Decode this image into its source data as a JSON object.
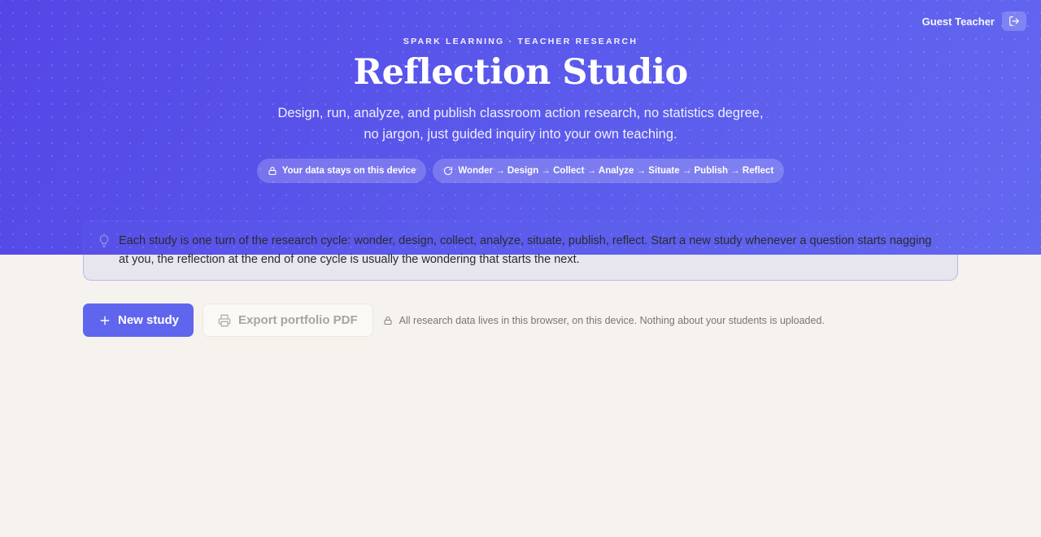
{
  "header": {
    "user_name": "Guest Teacher",
    "eyebrow": "SPARK LEARNING · TEACHER RESEARCH",
    "title": "Reflection Studio",
    "subtitle": "Design, run, analyze, and publish classroom action research, no statistics degree, no jargon, just guided inquiry into your own teaching.",
    "pills": [
      {
        "icon": "lock-icon",
        "label": "Your data stays on this device"
      },
      {
        "icon": "refresh-icon",
        "label": "Wonder → Design → Collect → Analyze → Situate → Publish → Reflect"
      }
    ]
  },
  "callout": {
    "icon": "lightbulb-icon",
    "text": "Each study is one turn of the research cycle: wonder, design, collect, analyze, situate, publish, reflect. Start a new study whenever a question starts nagging at you, the reflection at the end of one cycle is usually the wondering that starts the next."
  },
  "actions": {
    "new_study_label": "New study",
    "export_label": "Export portfolio PDF",
    "privacy_note": "All research data lives in this browser, on this device. Nothing about your students is uploaded."
  },
  "colors": {
    "accent": "#6065ee",
    "hero_start": "#5446e6",
    "hero_end": "#6368f0",
    "background": "#f6f3ee"
  }
}
